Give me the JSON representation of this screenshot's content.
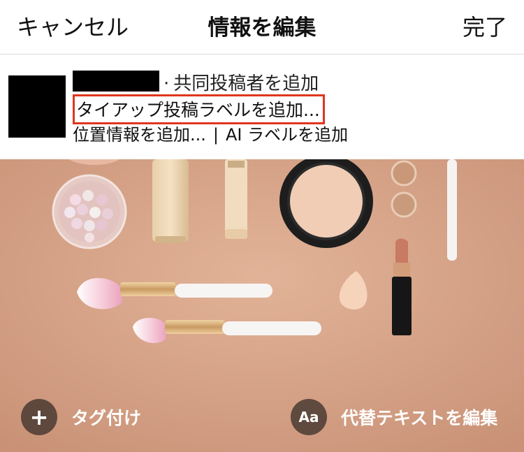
{
  "header": {
    "cancel_label": "キャンセル",
    "title": "情報を編集",
    "done_label": "完了"
  },
  "info": {
    "coauthor_label": "共同投稿者を追加",
    "separator": "·",
    "tieup_label": "タイアップ投稿ラベルを追加...",
    "location_label": "位置情報を追加...",
    "divider": "|",
    "ai_label": "AI ラベルを追加",
    "highlight_color": "#e0361f"
  },
  "photo": {
    "tag_icon": "+",
    "tag_label": "タグ付け",
    "alt_icon": "Aa",
    "alt_label": "代替テキストを編集",
    "background_color": "#d6a487"
  }
}
